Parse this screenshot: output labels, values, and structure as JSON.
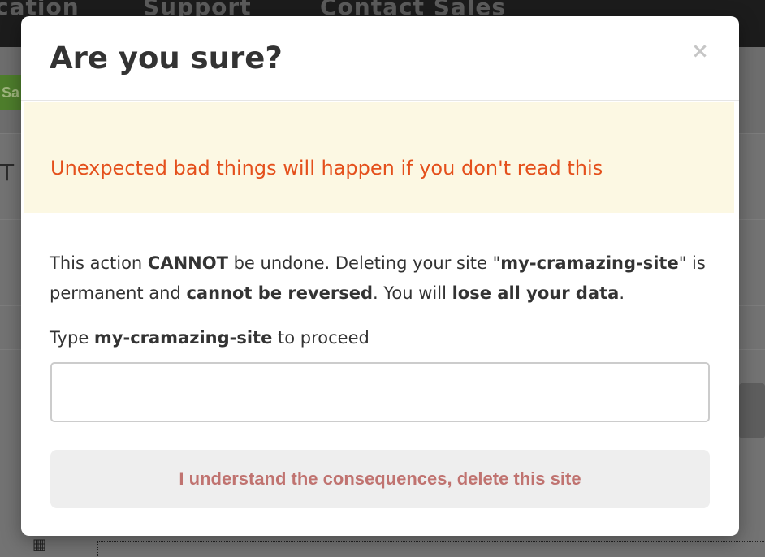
{
  "background": {
    "nav_items": [
      "cation",
      "Support",
      "Contact Sales"
    ],
    "save_partial": "Sa",
    "panel_partial": "T"
  },
  "modal": {
    "title": "Are you sure?",
    "close_glyph": "×",
    "warning": "Unexpected bad things will happen if you don't read this",
    "description": {
      "part1": "This action ",
      "cannot": "CANNOT",
      "part2": " be undone. Deleting your site \"",
      "site_name": "my-cramazing-site",
      "part3": "\" is permanent and ",
      "cannot_reversed": "cannot be reversed",
      "part4": ". You will ",
      "lose_data": "lose all your data",
      "part5": "."
    },
    "confirm_label": {
      "prefix": "Type ",
      "site_name": "my-cramazing-site",
      "suffix": " to proceed"
    },
    "confirm_input": {
      "value": "",
      "placeholder": ""
    },
    "delete_button_label": "I understand the consequences, delete this site"
  },
  "colors": {
    "warning_text": "#e4501c",
    "warning_bg": "#fcf8e3",
    "danger_button_text": "#c07370",
    "button_bg": "#eeeeee"
  }
}
